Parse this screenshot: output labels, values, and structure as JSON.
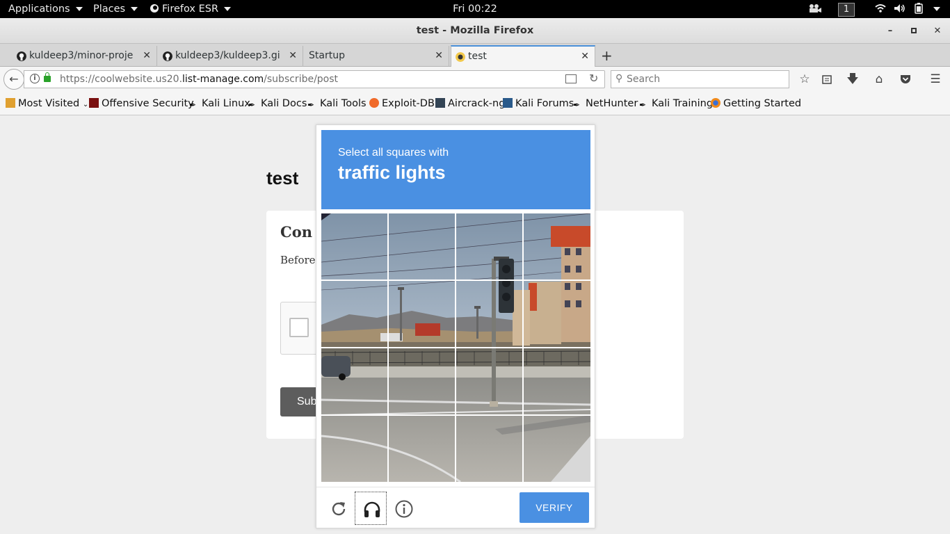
{
  "topbar": {
    "applications": "Applications",
    "places": "Places",
    "firefox": "Firefox ESR",
    "clock": "Fri 00:22",
    "workspace": "1"
  },
  "window": {
    "title": "test - Mozilla Firefox"
  },
  "tabs": [
    {
      "label": "kuldeep3/minor-proje...",
      "icon": "github-icon"
    },
    {
      "label": "kuldeep3/kuldeep3.gi...",
      "icon": "github-icon"
    },
    {
      "label": "Startup",
      "icon": ""
    },
    {
      "label": "test",
      "icon": "mailchimp-icon"
    }
  ],
  "nav": {
    "url_prefix": "https://coolwebsite.us20.",
    "url_domain": "list-manage.com",
    "url_path": "/subscribe/post",
    "search_placeholder": "Search"
  },
  "bookmarks": [
    "Most Visited",
    "Offensive Security",
    "Kali Linux",
    "Kali Docs",
    "Kali Tools",
    "Exploit-DB",
    "Aircrack-ng",
    "Kali Forums",
    "NetHunter",
    "Kali Training",
    "Getting Started"
  ],
  "page": {
    "title": "test",
    "card_heading": "Con",
    "card_text": "Before y",
    "submit_label": "Sub"
  },
  "captcha": {
    "prompt": "Select all squares with",
    "target": "traffic lights",
    "verify_label": "VERIFY",
    "header_color": "#4a90e2"
  }
}
